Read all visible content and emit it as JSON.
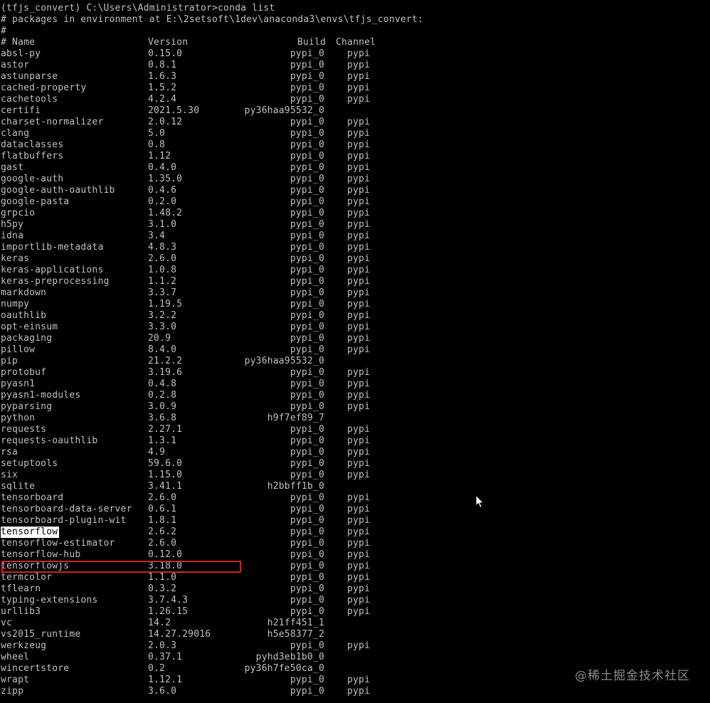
{
  "console": {
    "prompt": "(tfjs_convert) C:\\Users\\Administrator>conda list",
    "env_line": "# packages in environment at E:\\2setsoft\\1dev\\anaconda3\\envs\\tfjs_convert:",
    "hash_line": "#",
    "header": {
      "name": "# Name",
      "version": "Version",
      "build": "Build",
      "channel": "Channel"
    },
    "packages": [
      {
        "name": "absl-py",
        "version": "0.15.0",
        "build": "pypi_0",
        "channel": "pypi"
      },
      {
        "name": "astor",
        "version": "0.8.1",
        "build": "pypi_0",
        "channel": "pypi"
      },
      {
        "name": "astunparse",
        "version": "1.6.3",
        "build": "pypi_0",
        "channel": "pypi"
      },
      {
        "name": "cached-property",
        "version": "1.5.2",
        "build": "pypi_0",
        "channel": "pypi"
      },
      {
        "name": "cachetools",
        "version": "4.2.4",
        "build": "pypi_0",
        "channel": "pypi"
      },
      {
        "name": "certifi",
        "version": "2021.5.30",
        "build": "py36haa95532_0",
        "channel": ""
      },
      {
        "name": "charset-normalizer",
        "version": "2.0.12",
        "build": "pypi_0",
        "channel": "pypi"
      },
      {
        "name": "clang",
        "version": "5.0",
        "build": "pypi_0",
        "channel": "pypi"
      },
      {
        "name": "dataclasses",
        "version": "0.8",
        "build": "pypi_0",
        "channel": "pypi"
      },
      {
        "name": "flatbuffers",
        "version": "1.12",
        "build": "pypi_0",
        "channel": "pypi"
      },
      {
        "name": "gast",
        "version": "0.4.0",
        "build": "pypi_0",
        "channel": "pypi"
      },
      {
        "name": "google-auth",
        "version": "1.35.0",
        "build": "pypi_0",
        "channel": "pypi"
      },
      {
        "name": "google-auth-oauthlib",
        "version": "0.4.6",
        "build": "pypi_0",
        "channel": "pypi"
      },
      {
        "name": "google-pasta",
        "version": "0.2.0",
        "build": "pypi_0",
        "channel": "pypi"
      },
      {
        "name": "grpcio",
        "version": "1.48.2",
        "build": "pypi_0",
        "channel": "pypi"
      },
      {
        "name": "h5py",
        "version": "3.1.0",
        "build": "pypi_0",
        "channel": "pypi"
      },
      {
        "name": "idna",
        "version": "3.4",
        "build": "pypi_0",
        "channel": "pypi"
      },
      {
        "name": "importlib-metadata",
        "version": "4.8.3",
        "build": "pypi_0",
        "channel": "pypi"
      },
      {
        "name": "keras",
        "version": "2.6.0",
        "build": "pypi_0",
        "channel": "pypi"
      },
      {
        "name": "keras-applications",
        "version": "1.0.8",
        "build": "pypi_0",
        "channel": "pypi"
      },
      {
        "name": "keras-preprocessing",
        "version": "1.1.2",
        "build": "pypi_0",
        "channel": "pypi"
      },
      {
        "name": "markdown",
        "version": "3.3.7",
        "build": "pypi_0",
        "channel": "pypi"
      },
      {
        "name": "numpy",
        "version": "1.19.5",
        "build": "pypi_0",
        "channel": "pypi"
      },
      {
        "name": "oauthlib",
        "version": "3.2.2",
        "build": "pypi_0",
        "channel": "pypi"
      },
      {
        "name": "opt-einsum",
        "version": "3.3.0",
        "build": "pypi_0",
        "channel": "pypi"
      },
      {
        "name": "packaging",
        "version": "20.9",
        "build": "pypi_0",
        "channel": "pypi"
      },
      {
        "name": "pillow",
        "version": "8.4.0",
        "build": "pypi_0",
        "channel": "pypi"
      },
      {
        "name": "pip",
        "version": "21.2.2",
        "build": "py36haa95532_0",
        "channel": ""
      },
      {
        "name": "protobuf",
        "version": "3.19.6",
        "build": "pypi_0",
        "channel": "pypi"
      },
      {
        "name": "pyasn1",
        "version": "0.4.8",
        "build": "pypi_0",
        "channel": "pypi"
      },
      {
        "name": "pyasn1-modules",
        "version": "0.2.8",
        "build": "pypi_0",
        "channel": "pypi"
      },
      {
        "name": "pyparsing",
        "version": "3.0.9",
        "build": "pypi_0",
        "channel": "pypi"
      },
      {
        "name": "python",
        "version": "3.6.8",
        "build": "h9f7ef89_7",
        "channel": ""
      },
      {
        "name": "requests",
        "version": "2.27.1",
        "build": "pypi_0",
        "channel": "pypi"
      },
      {
        "name": "requests-oauthlib",
        "version": "1.3.1",
        "build": "pypi_0",
        "channel": "pypi"
      },
      {
        "name": "rsa",
        "version": "4.9",
        "build": "pypi_0",
        "channel": "pypi"
      },
      {
        "name": "setuptools",
        "version": "59.6.0",
        "build": "pypi_0",
        "channel": "pypi"
      },
      {
        "name": "six",
        "version": "1.15.0",
        "build": "pypi_0",
        "channel": "pypi"
      },
      {
        "name": "sqlite",
        "version": "3.41.1",
        "build": "h2bbff1b_0",
        "channel": ""
      },
      {
        "name": "tensorboard",
        "version": "2.6.0",
        "build": "pypi_0",
        "channel": "pypi"
      },
      {
        "name": "tensorboard-data-server",
        "version": "0.6.1",
        "build": "pypi_0",
        "channel": "pypi"
      },
      {
        "name": "tensorboard-plugin-wit",
        "version": "1.8.1",
        "build": "pypi_0",
        "channel": "pypi"
      },
      {
        "name": "tensorflow",
        "version": "2.6.2",
        "build": "pypi_0",
        "channel": "pypi",
        "selected": true
      },
      {
        "name": "tensorflow-estimator",
        "version": "2.6.0",
        "build": "pypi_0",
        "channel": "pypi"
      },
      {
        "name": "tensorflow-hub",
        "version": "0.12.0",
        "build": "pypi_0",
        "channel": "pypi"
      },
      {
        "name": "tensorflowjs",
        "version": "3.18.0",
        "build": "pypi_0",
        "channel": "pypi",
        "boxed": true
      },
      {
        "name": "termcolor",
        "version": "1.1.0",
        "build": "pypi_0",
        "channel": "pypi"
      },
      {
        "name": "tflearn",
        "version": "0.3.2",
        "build": "pypi_0",
        "channel": "pypi"
      },
      {
        "name": "typing-extensions",
        "version": "3.7.4.3",
        "build": "pypi_0",
        "channel": "pypi"
      },
      {
        "name": "urllib3",
        "version": "1.26.15",
        "build": "pypi_0",
        "channel": "pypi"
      },
      {
        "name": "vc",
        "version": "14.2",
        "build": "h21ff451_1",
        "channel": ""
      },
      {
        "name": "vs2015_runtime",
        "version": "14.27.29016",
        "build": "h5e58377_2",
        "channel": ""
      },
      {
        "name": "werkzeug",
        "version": "2.0.3",
        "build": "pypi_0",
        "channel": "pypi"
      },
      {
        "name": "wheel",
        "version": "0.37.1",
        "build": "pyhd3eb1b0_0",
        "channel": ""
      },
      {
        "name": "wincertstore",
        "version": "0.2",
        "build": "py36h7fe50ca_0",
        "channel": ""
      },
      {
        "name": "wrapt",
        "version": "1.12.1",
        "build": "pypi_0",
        "channel": "pypi"
      },
      {
        "name": "zipp",
        "version": "3.6.0",
        "build": "pypi_0",
        "channel": "pypi"
      }
    ]
  },
  "watermark": "@稀土掘金技术社区",
  "colors": {
    "background": "#000000",
    "text": "#c0c0c0",
    "highlight_box": "#c8262c",
    "selection_bg": "#ffffff",
    "selection_fg": "#000000"
  },
  "icons": {
    "cursor": "mouse-pointer-icon"
  }
}
